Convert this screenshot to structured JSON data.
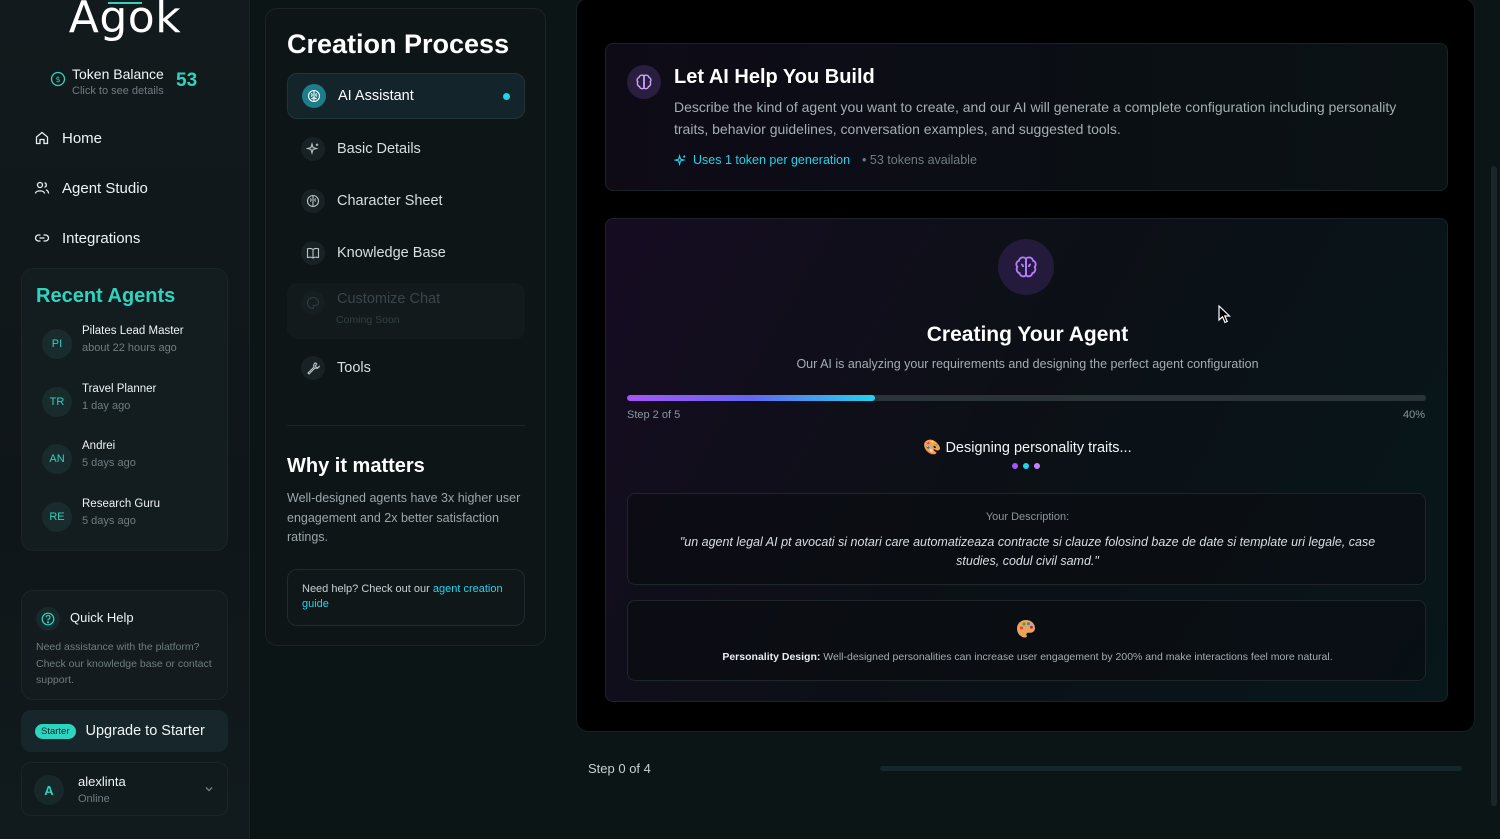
{
  "sidebar": {
    "logo": "Agok",
    "token": {
      "title": "Token Balance",
      "subtitle": "Click to see details",
      "count": "53"
    },
    "nav": [
      {
        "label": "Home",
        "icon": "home-icon"
      },
      {
        "label": "Agent Studio",
        "icon": "users-icon"
      },
      {
        "label": "Integrations",
        "icon": "link-icon"
      }
    ],
    "recent": {
      "title": "Recent Agents",
      "agents": [
        {
          "initials": "PI",
          "name": "Pilates Lead Master",
          "time": "about 22 hours ago"
        },
        {
          "initials": "TR",
          "name": "Travel Planner",
          "time": "1 day ago"
        },
        {
          "initials": "AN",
          "name": "Andrei",
          "time": "5 days ago"
        },
        {
          "initials": "RE",
          "name": "Research Guru",
          "time": "5 days ago"
        }
      ]
    },
    "help": {
      "title": "Quick Help",
      "text": "Need assistance with the platform? Check our knowledge base or contact support."
    },
    "upgrade": {
      "badge": "Starter",
      "label": "Upgrade to Starter"
    },
    "user": {
      "initial": "A",
      "name": "alexlinta",
      "status": "Online"
    }
  },
  "steps": {
    "title": "Creation Process",
    "items": [
      {
        "label": "AI Assistant",
        "icon": "ai-brain-icon",
        "active": true
      },
      {
        "label": "Basic Details",
        "icon": "sparkle-icon"
      },
      {
        "label": "Character Sheet",
        "icon": "brain-icon"
      },
      {
        "label": "Knowledge Base",
        "icon": "book-icon"
      },
      {
        "label": "Customize Chat",
        "icon": "palette-icon",
        "sub": "Coming Soon",
        "disabled": true
      },
      {
        "label": "Tools",
        "icon": "wrench-icon"
      }
    ],
    "why_title": "Why it matters",
    "why_text": "Well-designed agents have 3x higher user engagement and 2x better satisfaction ratings.",
    "guide_prefix": "Need help? Check out our ",
    "guide_link": "agent creation guide"
  },
  "main": {
    "help_build": {
      "title": "Let AI Help You Build",
      "description": "Describe the kind of agent you want to create, and our AI will generate a complete configuration including personality traits, behavior guidelines, conversation examples, and suggested tools.",
      "uses": "Uses 1 token per generation",
      "available": "• 53 tokens available"
    },
    "creating": {
      "title": "Creating Your Agent",
      "subtitle": "Our AI is analyzing your requirements and designing the perfect agent configuration",
      "progress": 0.31,
      "step_label": "Step 2 of 5",
      "percent_label": "40%",
      "status": "🎨 Designing personality traits...",
      "dot_colors": [
        "#a855f7",
        "#22d3ee",
        "#c084fc"
      ],
      "desc_label": "Your Description:",
      "desc_text": "\"un agent legal AI pt avocati si notari care automatizeaza contracte si clauze folosind baze de date si template uri legale, case studies, codul civil samd.\"",
      "tip_bold": "Personality Design:",
      "tip_text": " Well-designed personalities can increase user engagement by 200% and make interactions feel more natural."
    },
    "bottom_step": "Step 0 of 4"
  },
  "colors": {
    "accent": "#2dd4bf",
    "cyan": "#22d3ee",
    "purple": "#a855f7"
  }
}
